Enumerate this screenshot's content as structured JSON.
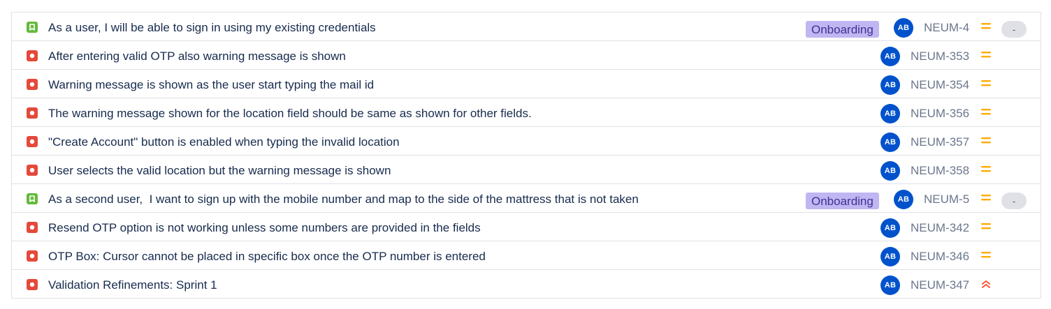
{
  "colors": {
    "story": "#63ba3c",
    "bug": "#e5493a",
    "label_bg": "#c0b6f2",
    "label_text": "#403294",
    "avatar_bg": "#0052cc",
    "priority_medium": "#ffab00",
    "priority_highest": "#ff5630"
  },
  "issues": [
    {
      "type": "story",
      "summary": "As a user, I will be able to sign in using my existing credentials",
      "label": "Onboarding",
      "assignee": "AB",
      "key": "NEUM-4",
      "priority": "medium",
      "status": "-"
    },
    {
      "type": "bug",
      "summary": "After entering valid OTP also warning message is shown",
      "assignee": "AB",
      "key": "NEUM-353",
      "priority": "medium"
    },
    {
      "type": "bug",
      "summary": "Warning message is shown as the user start typing the mail id",
      "assignee": "AB",
      "key": "NEUM-354",
      "priority": "medium"
    },
    {
      "type": "bug",
      "summary": "The warning message shown for the location field should be same as shown for other fields.",
      "assignee": "AB",
      "key": "NEUM-356",
      "priority": "medium"
    },
    {
      "type": "bug",
      "summary": "\"Create Account\" button is enabled when typing the invalid location",
      "assignee": "AB",
      "key": "NEUM-357",
      "priority": "medium"
    },
    {
      "type": "bug",
      "summary": "User selects the valid location but the warning message is shown",
      "assignee": "AB",
      "key": "NEUM-358",
      "priority": "medium"
    },
    {
      "type": "story",
      "summary": "As a second user,  I want to sign up with the mobile number and map to the side of the mattress that is not taken",
      "label": "Onboarding",
      "assignee": "AB",
      "key": "NEUM-5",
      "priority": "medium",
      "status": "-"
    },
    {
      "type": "bug",
      "summary": "Resend OTP option is not working unless some numbers are provided in the fields",
      "assignee": "AB",
      "key": "NEUM-342",
      "priority": "medium"
    },
    {
      "type": "bug",
      "summary": "OTP Box: Cursor cannot be placed in specific box once the OTP number is entered",
      "assignee": "AB",
      "key": "NEUM-346",
      "priority": "medium"
    },
    {
      "type": "bug",
      "summary": "Validation Refinements: Sprint 1",
      "assignee": "AB",
      "key": "NEUM-347",
      "priority": "highest"
    }
  ]
}
